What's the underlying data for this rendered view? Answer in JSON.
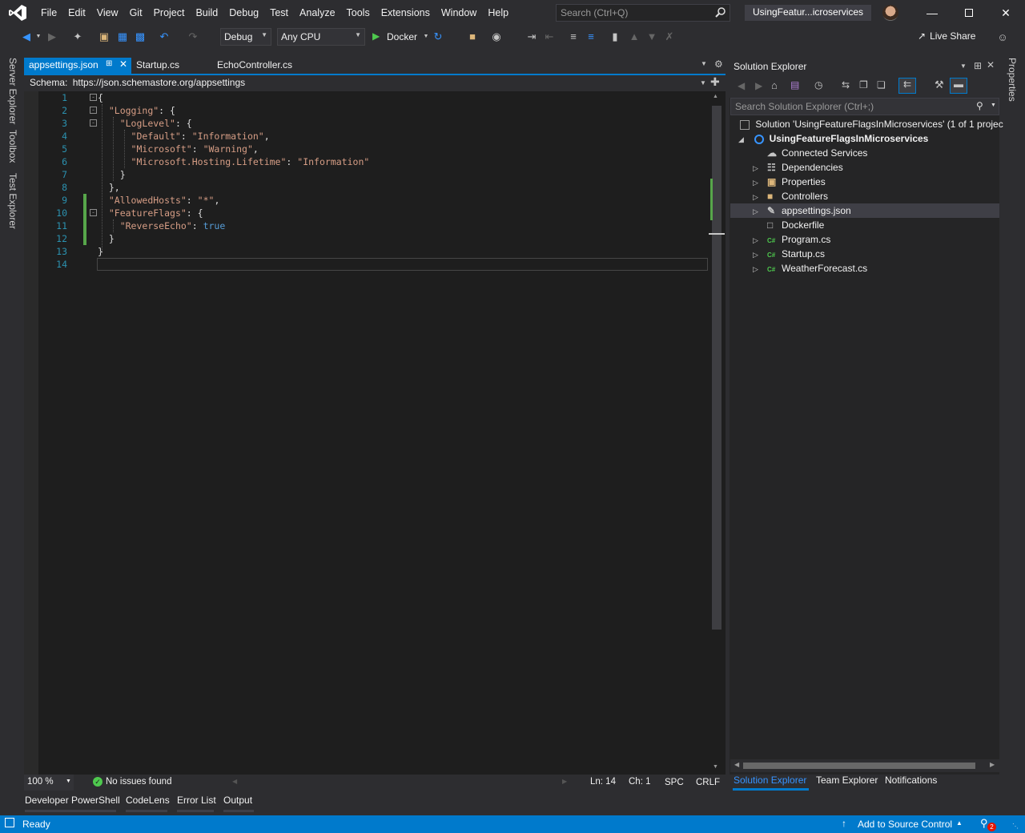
{
  "menu": [
    "File",
    "Edit",
    "View",
    "Git",
    "Project",
    "Build",
    "Debug",
    "Test",
    "Analyze",
    "Tools",
    "Extensions",
    "Window",
    "Help"
  ],
  "search": {
    "placeholder": "Search (Ctrl+Q)"
  },
  "window_title": "UsingFeatur...icroservices",
  "toolbar": {
    "config": "Debug",
    "platform": "Any CPU",
    "run_target": "Docker",
    "live_share": "Live Share"
  },
  "left_strip": [
    "Server Explorer",
    "Toolbox",
    "Test Explorer"
  ],
  "right_strip": [
    "Properties"
  ],
  "editor": {
    "tabs": [
      {
        "label": "appsettings.json",
        "active": true
      },
      {
        "label": "Startup.cs",
        "active": false
      },
      {
        "label": "EchoController.cs",
        "active": false
      }
    ],
    "schema_label": "Schema:",
    "schema_url": "https://json.schemastore.org/appsettings",
    "line_numbers": [
      "1",
      "2",
      "3",
      "4",
      "5",
      "6",
      "7",
      "8",
      "9",
      "10",
      "11",
      "12",
      "13",
      "14"
    ],
    "lines": [
      "{",
      "  \"Logging\": {",
      "    \"LogLevel\": {",
      "      \"Default\": \"Information\",",
      "      \"Microsoft\": \"Warning\",",
      "      \"Microsoft.Hosting.Lifetime\": \"Information\"",
      "    }",
      "  },",
      "  \"AllowedHosts\": \"*\",",
      "  \"FeatureFlags\": {",
      "    \"ReverseEcho\": true",
      "  }",
      "}",
      ""
    ],
    "zoom": "100 %",
    "issues": "No issues found",
    "position": {
      "ln": "Ln: 14",
      "ch": "Ch: 1",
      "spc": "SPC",
      "eol": "CRLF"
    }
  },
  "bottom_tabs": [
    "Developer PowerShell",
    "CodeLens",
    "Error List",
    "Output"
  ],
  "solution_explorer": {
    "title": "Solution Explorer",
    "search_placeholder": "Search Solution Explorer (Ctrl+;)",
    "solution": "Solution 'UsingFeatureFlagsInMicroservices' (1 of 1 projec",
    "project": "UsingFeatureFlagsInMicroservices",
    "items": [
      {
        "label": "Connected Services",
        "icon": "cloud-icon",
        "expandable": false
      },
      {
        "label": "Dependencies",
        "icon": "dependencies-icon",
        "expandable": true
      },
      {
        "label": "Properties",
        "icon": "properties-icon",
        "expandable": true
      },
      {
        "label": "Controllers",
        "icon": "folder-icon",
        "expandable": true
      },
      {
        "label": "appsettings.json",
        "icon": "json-file-icon",
        "expandable": true,
        "selected": true
      },
      {
        "label": "Dockerfile",
        "icon": "file-icon",
        "expandable": false
      },
      {
        "label": "Program.cs",
        "icon": "csharp-icon",
        "expandable": true
      },
      {
        "label": "Startup.cs",
        "icon": "csharp-icon",
        "expandable": true
      },
      {
        "label": "WeatherForecast.cs",
        "icon": "csharp-icon",
        "expandable": true
      }
    ],
    "tabs": [
      "Solution Explorer",
      "Team Explorer",
      "Notifications"
    ]
  },
  "statusbar": {
    "ready": "Ready",
    "source_control": "Add to Source Control",
    "notif_count": "2"
  },
  "colors": {
    "accent": "#007acc",
    "editor_bg": "#1e1e1e",
    "chrome": "#2d2d30",
    "string": "#d69d85",
    "keyword": "#569cd6",
    "linenum": "#2b91af"
  }
}
